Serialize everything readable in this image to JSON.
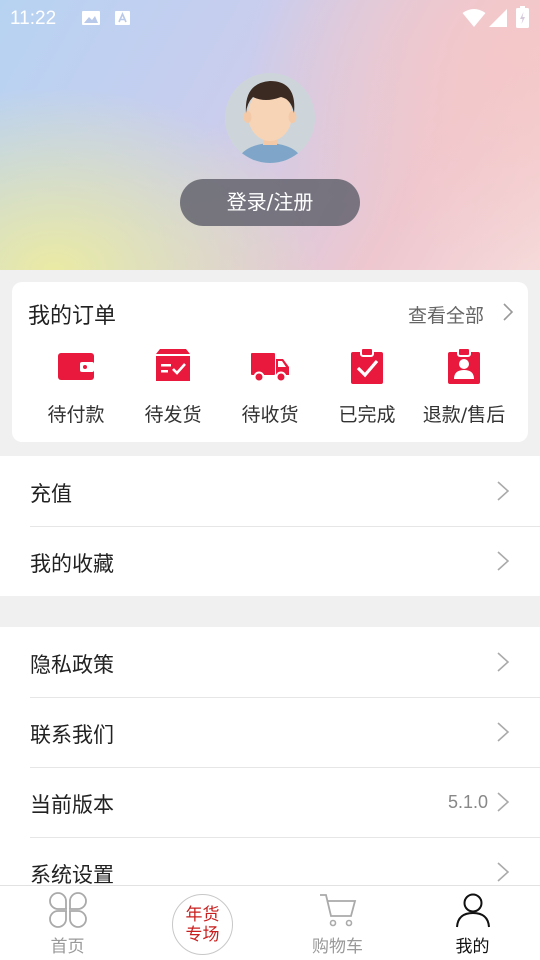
{
  "status_bar": {
    "time": "11:22"
  },
  "header": {
    "login_label": "登录/注册"
  },
  "orders": {
    "title": "我的订单",
    "view_all": "查看全部",
    "items": [
      {
        "label": "待付款",
        "icon": "wallet-icon"
      },
      {
        "label": "待发货",
        "icon": "package-check-icon"
      },
      {
        "label": "待收货",
        "icon": "truck-icon"
      },
      {
        "label": "已完成",
        "icon": "clipboard-check-icon"
      },
      {
        "label": "退款/售后",
        "icon": "clipboard-user-icon"
      }
    ]
  },
  "menu_group1": [
    {
      "label": "充值"
    },
    {
      "label": "我的收藏"
    }
  ],
  "menu_group2": [
    {
      "label": "隐私政策"
    },
    {
      "label": "联系我们"
    },
    {
      "label": "当前版本",
      "value": "5.1.0"
    },
    {
      "label": "系统设置"
    }
  ],
  "bottom_nav": {
    "home": "首页",
    "promo_line1": "年货",
    "promo_line2": "专场",
    "cart": "购物车",
    "mine": "我的"
  },
  "colors": {
    "accent": "#e8193c",
    "header_button": "#6e6b73"
  }
}
